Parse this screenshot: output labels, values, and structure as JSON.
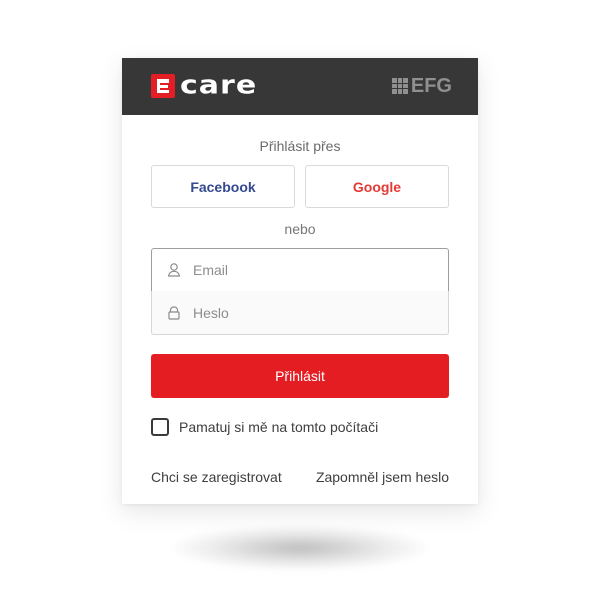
{
  "brand": {
    "name": "care",
    "mark_letter": "e",
    "partner": "EFG"
  },
  "login": {
    "with_label": "Přihlásit přes",
    "facebook_label": "Facebook",
    "google_label": "Google",
    "or_label": "nebo",
    "email_placeholder": "Email",
    "password_placeholder": "Heslo",
    "submit_label": "Přihlásit",
    "remember_label": "Pamatuj si mě na tomto počítači",
    "register_label": "Chci se zaregistrovat",
    "forgot_label": "Zapomněl jsem heslo"
  },
  "colors": {
    "header": "#373737",
    "primary": "#e41d22",
    "facebook": "#34498f",
    "google": "#e53935",
    "text": "#3e3e3e",
    "muted": "#8d8d8d"
  },
  "icons": {
    "email": "user-icon",
    "password": "lock-icon",
    "partner": "grid-icon"
  }
}
